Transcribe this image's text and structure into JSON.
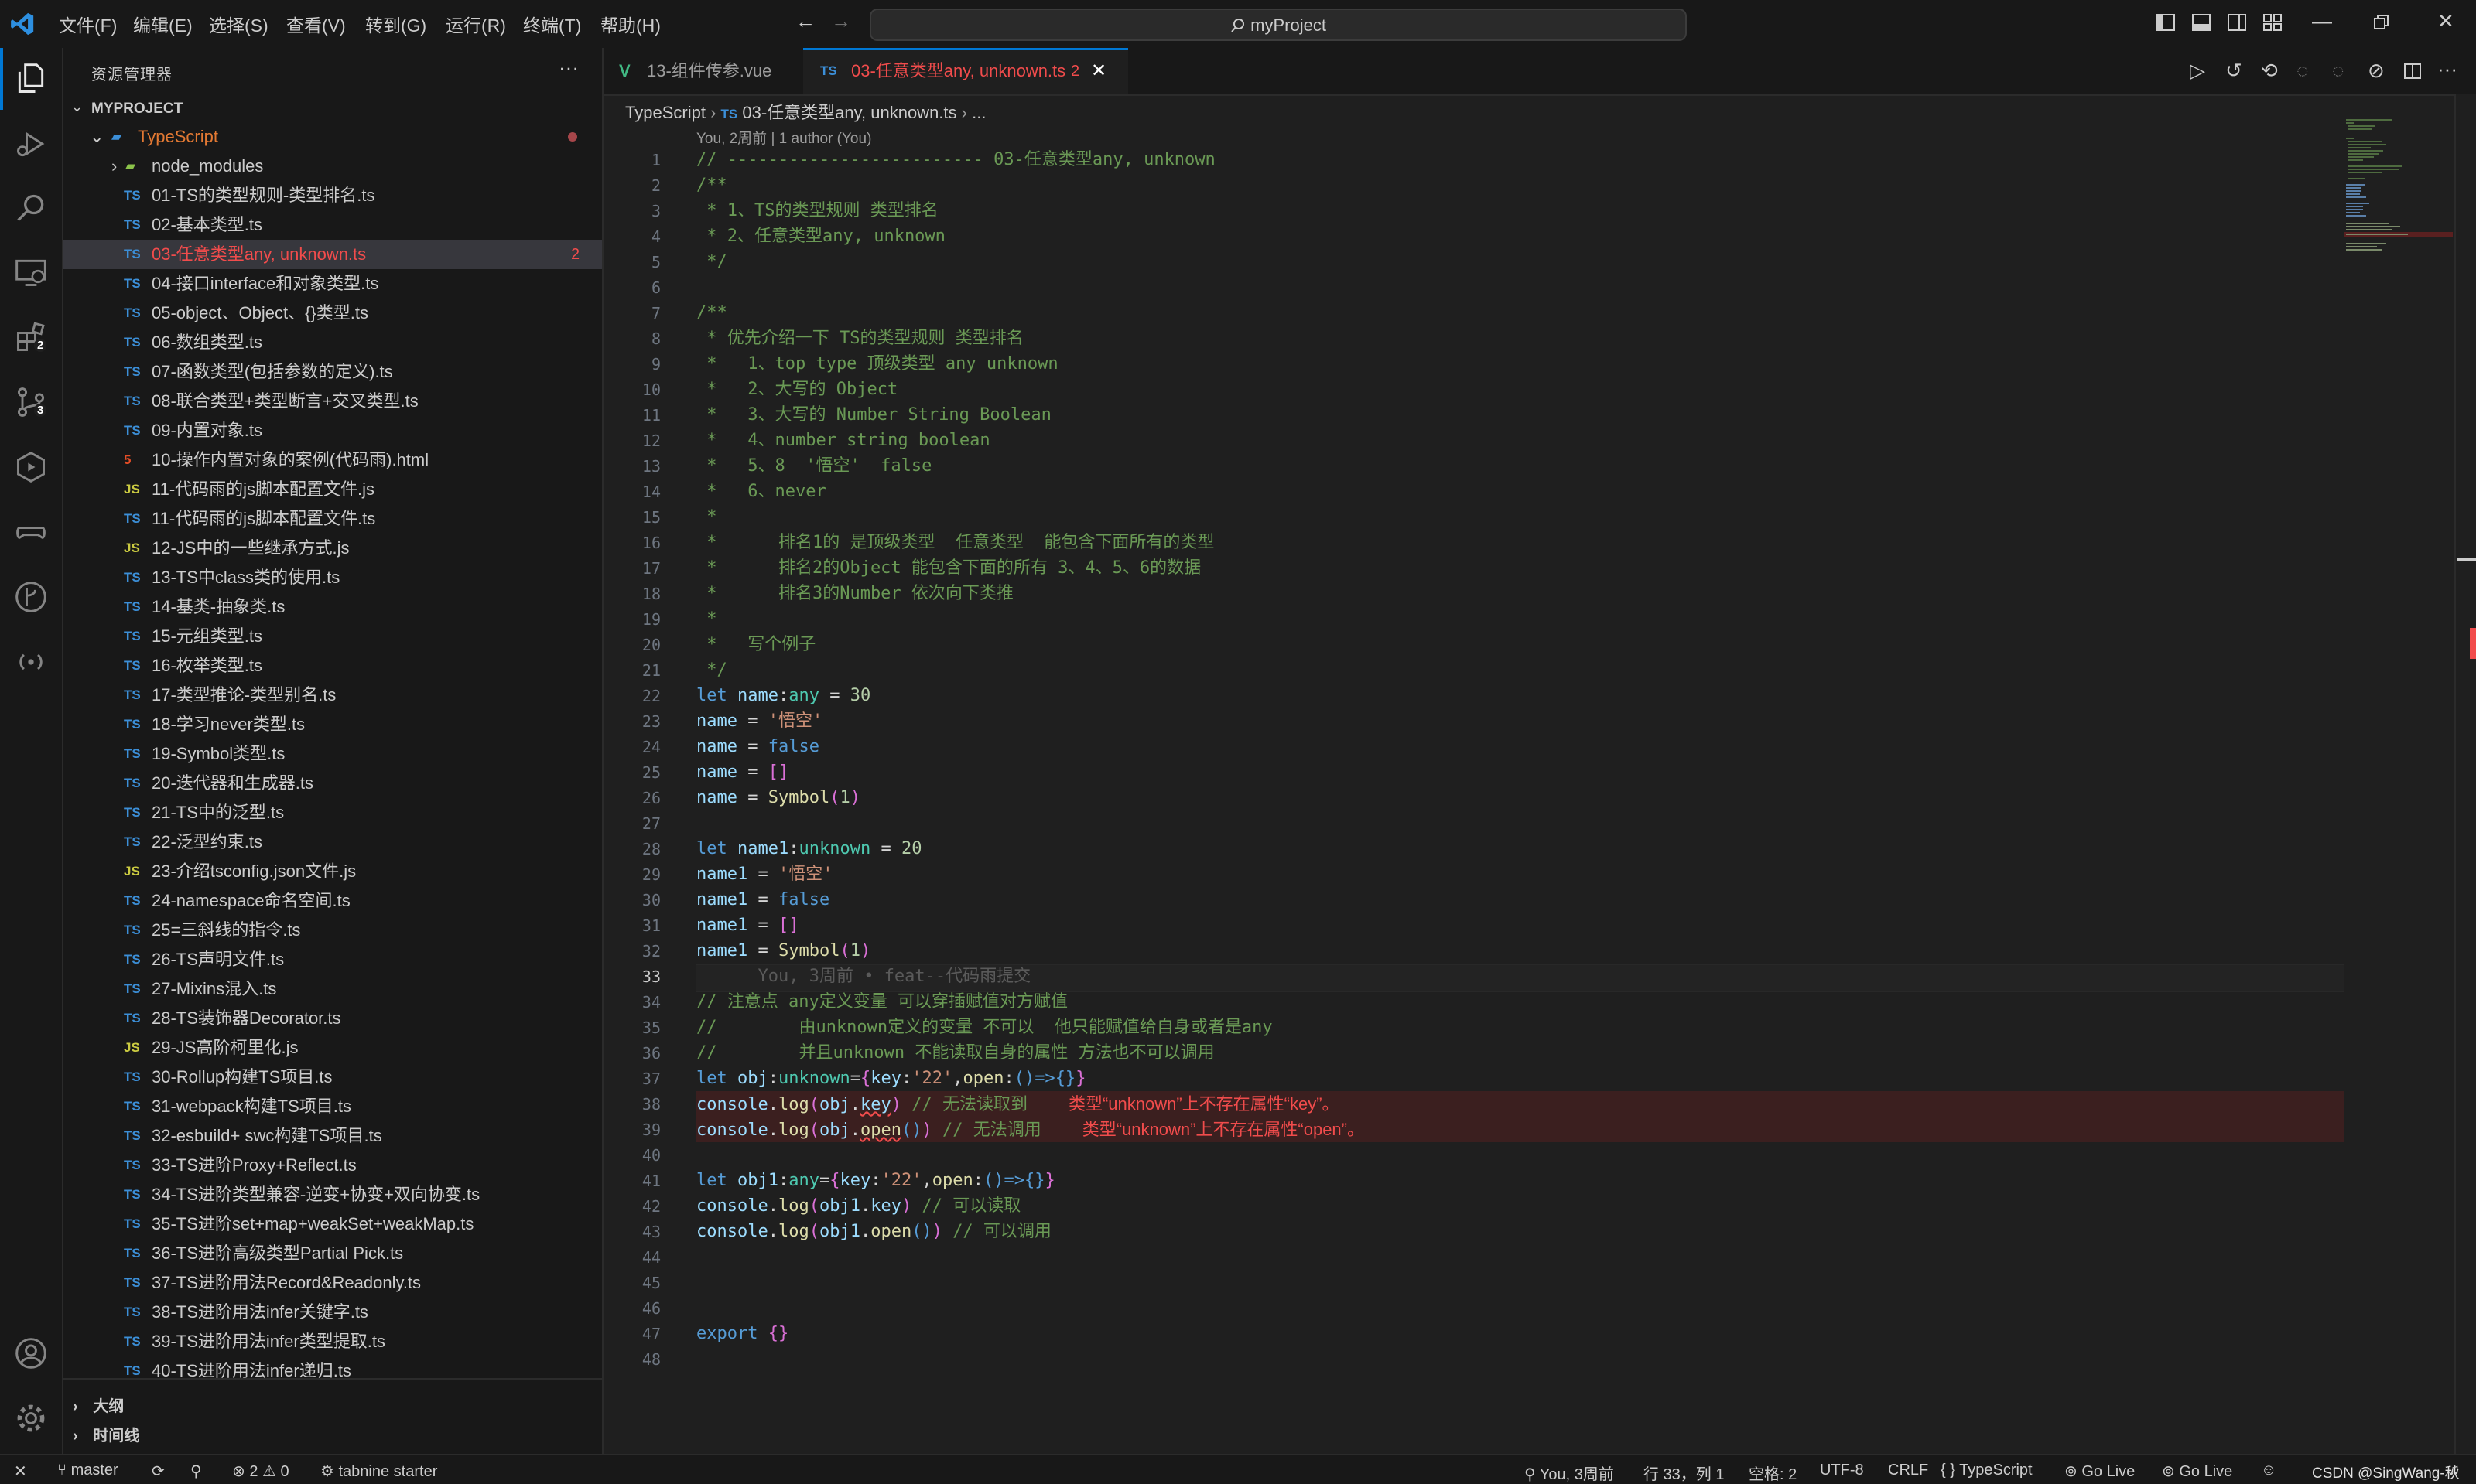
{
  "titlebar": {
    "menu": [
      "文件(F)",
      "编辑(E)",
      "选择(S)",
      "查看(V)",
      "转到(G)",
      "运行(R)",
      "终端(T)",
      "帮助(H)"
    ],
    "search": "myProject"
  },
  "activity": {
    "extensions_badge": "2",
    "scm_badge": "3"
  },
  "sidebar": {
    "title": "资源管理器",
    "project": "MYPROJECT",
    "folder": "TypeScript",
    "subfolder": "node_modules",
    "files": [
      {
        "icon": "TS",
        "name": "01-TS的类型规则-类型排名.ts"
      },
      {
        "icon": "TS",
        "name": "02-基本类型.ts"
      },
      {
        "icon": "TS",
        "name": "03-任意类型any, unknown.ts",
        "badge": "2"
      },
      {
        "icon": "TS",
        "name": "04-接口interface和对象类型.ts"
      },
      {
        "icon": "TS",
        "name": "05-object、Object、{}类型.ts"
      },
      {
        "icon": "TS",
        "name": "06-数组类型.ts"
      },
      {
        "icon": "TS",
        "name": "07-函数类型(包括参数的定义).ts"
      },
      {
        "icon": "TS",
        "name": "08-联合类型+类型断言+交叉类型.ts"
      },
      {
        "icon": "TS",
        "name": "09-内置对象.ts"
      },
      {
        "icon": "5",
        "name": "10-操作内置对象的案例(代码雨).html"
      },
      {
        "icon": "JS",
        "name": "11-代码雨的js脚本配置文件.js"
      },
      {
        "icon": "TS",
        "name": "11-代码雨的js脚本配置文件.ts"
      },
      {
        "icon": "JS",
        "name": "12-JS中的一些继承方式.js"
      },
      {
        "icon": "TS",
        "name": "13-TS中class类的使用.ts"
      },
      {
        "icon": "TS",
        "name": "14-基类-抽象类.ts"
      },
      {
        "icon": "TS",
        "name": "15-元组类型.ts"
      },
      {
        "icon": "TS",
        "name": "16-枚举类型.ts"
      },
      {
        "icon": "TS",
        "name": "17-类型推论-类型别名.ts"
      },
      {
        "icon": "TS",
        "name": "18-学习never类型.ts"
      },
      {
        "icon": "TS",
        "name": "19-Symbol类型.ts"
      },
      {
        "icon": "TS",
        "name": "20-迭代器和生成器.ts"
      },
      {
        "icon": "TS",
        "name": "21-TS中的泛型.ts"
      },
      {
        "icon": "TS",
        "name": "22-泛型约束.ts"
      },
      {
        "icon": "JS",
        "name": "23-介绍tsconfig.json文件.js"
      },
      {
        "icon": "TS",
        "name": "24-namespace命名空间.ts"
      },
      {
        "icon": "TS",
        "name": "25=三斜线的指令.ts"
      },
      {
        "icon": "TS",
        "name": "26-TS声明文件.ts"
      },
      {
        "icon": "TS",
        "name": "27-Mixins混入.ts"
      },
      {
        "icon": "TS",
        "name": "28-TS装饰器Decorator.ts"
      },
      {
        "icon": "JS",
        "name": "29-JS高阶柯里化.js"
      },
      {
        "icon": "TS",
        "name": "30-Rollup构建TS项目.ts"
      },
      {
        "icon": "TS",
        "name": "31-webpack构建TS项目.ts"
      },
      {
        "icon": "TS",
        "name": "32-esbuild+ swc构建TS项目.ts"
      },
      {
        "icon": "TS",
        "name": "33-TS进阶Proxy+Reflect.ts"
      },
      {
        "icon": "TS",
        "name": "34-TS进阶类型兼容-逆变+协变+双向协变.ts"
      },
      {
        "icon": "TS",
        "name": "35-TS进阶set+map+weakSet+weakMap.ts"
      },
      {
        "icon": "TS",
        "name": "36-TS进阶高级类型Partial Pick.ts"
      },
      {
        "icon": "TS",
        "name": "37-TS进阶用法Record&Readonly.ts"
      },
      {
        "icon": "TS",
        "name": "38-TS进阶用法infer关键字.ts"
      },
      {
        "icon": "TS",
        "name": "39-TS进阶用法infer类型提取.ts"
      },
      {
        "icon": "TS",
        "name": "40-TS进阶用法infer递归.ts"
      }
    ],
    "outline": "大纲",
    "timeline": "时间线"
  },
  "tabs": [
    {
      "icon": "V",
      "label": "13-组件传参.vue"
    },
    {
      "icon": "TS",
      "label": "03-任意类型any, unknown.ts",
      "badge": "2"
    }
  ],
  "breadcrumb": {
    "folder": "TypeScript",
    "file": "03-任意类型any, unknown.ts",
    "tail": "..."
  },
  "codelens": "You, 2周前 | 1 author (You)",
  "editor": {
    "line_numbers": [
      "1",
      "2",
      "3",
      "4",
      "5",
      "6",
      "7",
      "8",
      "9",
      "10",
      "11",
      "12",
      "13",
      "14",
      "15",
      "16",
      "17",
      "18",
      "19",
      "20",
      "21",
      "22",
      "23",
      "24",
      "25",
      "26",
      "27",
      "28",
      "29",
      "30",
      "31",
      "32",
      "33",
      "34",
      "35",
      "36",
      "37",
      "38",
      "39",
      "40",
      "41",
      "42",
      "43",
      "44",
      "45",
      "46",
      "47",
      "48"
    ],
    "active_line": 33,
    "blame_text": "You, 3周前 • feat--代码雨提交",
    "error1": "类型“unknown”上不存在属性“key”。",
    "error2": "类型“unknown”上不存在属性“open”。"
  },
  "statusbar": {
    "branch": "master",
    "problems": "2",
    "warnings": "0",
    "tabnine": "tabnine starter",
    "blame": "You, 3周前",
    "position": "行 33，列 1",
    "spaces": "空格: 2",
    "encoding": "UTF-8",
    "eol": "CRLF",
    "language": "TypeScript",
    "golive1": "Go Live",
    "golive2": "Go Live",
    "watermark": "CSDN @SingWang-秋"
  },
  "colors": {
    "accent": "#0078d4",
    "error": "#f14c4c",
    "ts_icon": "#3c8fd8",
    "js_icon": "#cbcb41",
    "html_icon": "#e44d26",
    "vue_icon": "#41b883"
  }
}
